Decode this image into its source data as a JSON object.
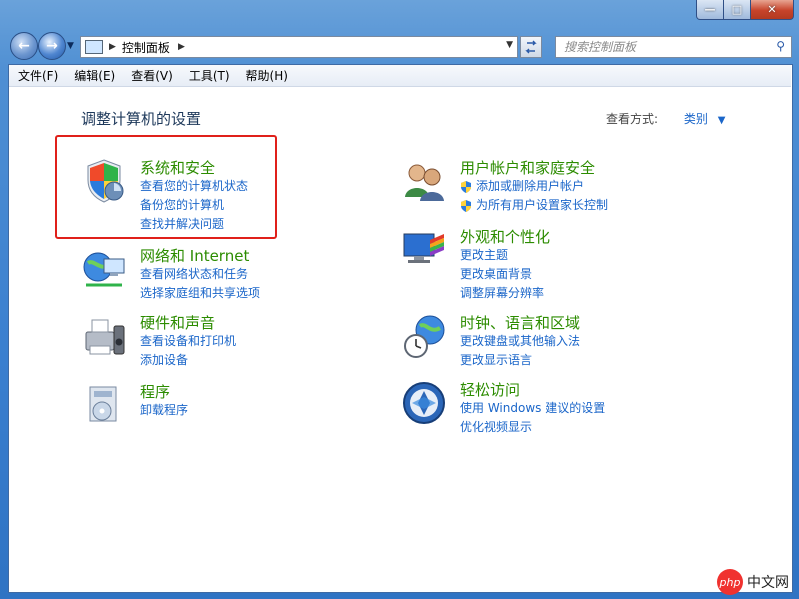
{
  "window": {
    "title_buttons": [
      "minimize",
      "maximize",
      "close"
    ]
  },
  "address_bar": {
    "path": "控制面板",
    "search_placeholder": "搜索控制面板"
  },
  "menu": [
    "文件(F)",
    "编辑(E)",
    "查看(V)",
    "工具(T)",
    "帮助(H)"
  ],
  "content": {
    "heading": "调整计算机的设置",
    "view_by_label": "查看方式:",
    "view_by_value": "类别"
  },
  "categories": [
    {
      "title": "系统和安全",
      "icon": "shield-icon",
      "links": [
        "查看您的计算机状态",
        "备份您的计算机",
        "查找并解决问题"
      ]
    },
    {
      "title": "网络和 Internet",
      "icon": "network-icon",
      "links": [
        "查看网络状态和任务",
        "选择家庭组和共享选项"
      ]
    },
    {
      "title": "硬件和声音",
      "icon": "printer-icon",
      "links": [
        "查看设备和打印机",
        "添加设备"
      ]
    },
    {
      "title": "程序",
      "icon": "programs-icon",
      "links": [
        "卸载程序"
      ]
    },
    {
      "title": "用户帐户和家庭安全",
      "icon": "users-icon",
      "links": [
        "添加或删除用户帐户",
        "为所有用户设置家长控制"
      ]
    },
    {
      "title": "外观和个性化",
      "icon": "appearance-icon",
      "links": [
        "更改主题",
        "更改桌面背景",
        "调整屏幕分辨率"
      ]
    },
    {
      "title": "时钟、语言和区域",
      "icon": "clock-globe-icon",
      "links": [
        "更改键盘或其他输入法",
        "更改显示语言"
      ]
    },
    {
      "title": "轻松访问",
      "icon": "ease-of-access-icon",
      "links": [
        "使用 Windows 建议的设置",
        "优化视频显示"
      ]
    }
  ],
  "watermark": {
    "badge": "php",
    "site": "中文网"
  },
  "colors": {
    "category_title": "#2c8c00",
    "link": "#1b66c9",
    "highlight_box": "#e0201a"
  }
}
